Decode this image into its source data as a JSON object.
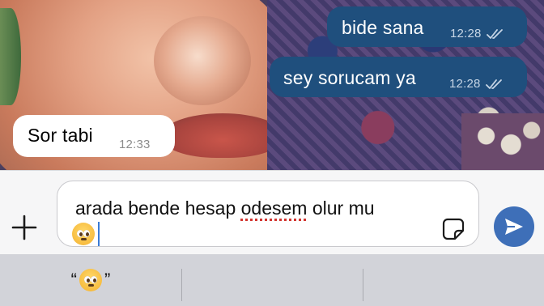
{
  "messages": [
    {
      "direction": "outgoing",
      "text": "bide sana",
      "time": "12:28",
      "status": "read"
    },
    {
      "direction": "outgoing",
      "text": "sey sorucam ya",
      "time": "12:28",
      "status": "read"
    },
    {
      "direction": "incoming",
      "text": "Sor tabi",
      "time": "12:33"
    }
  ],
  "composer": {
    "text_before": "arada bende hesap ",
    "misspelled": "odesem",
    "text_after": " olur mu",
    "emoji": "pleading-face",
    "attach_icon": "plus-icon",
    "sticker_icon": "sticker-icon",
    "send_icon": "send-arrow-icon"
  },
  "suggestions": {
    "open_quote": "“",
    "close_quote": "”",
    "emoji": "pleading-face"
  },
  "colors": {
    "outgoing_bubble": "#1f4f7d",
    "incoming_bubble": "#ffffff",
    "send_button": "#3e6fb8",
    "spell_underline": "#d2342f"
  }
}
